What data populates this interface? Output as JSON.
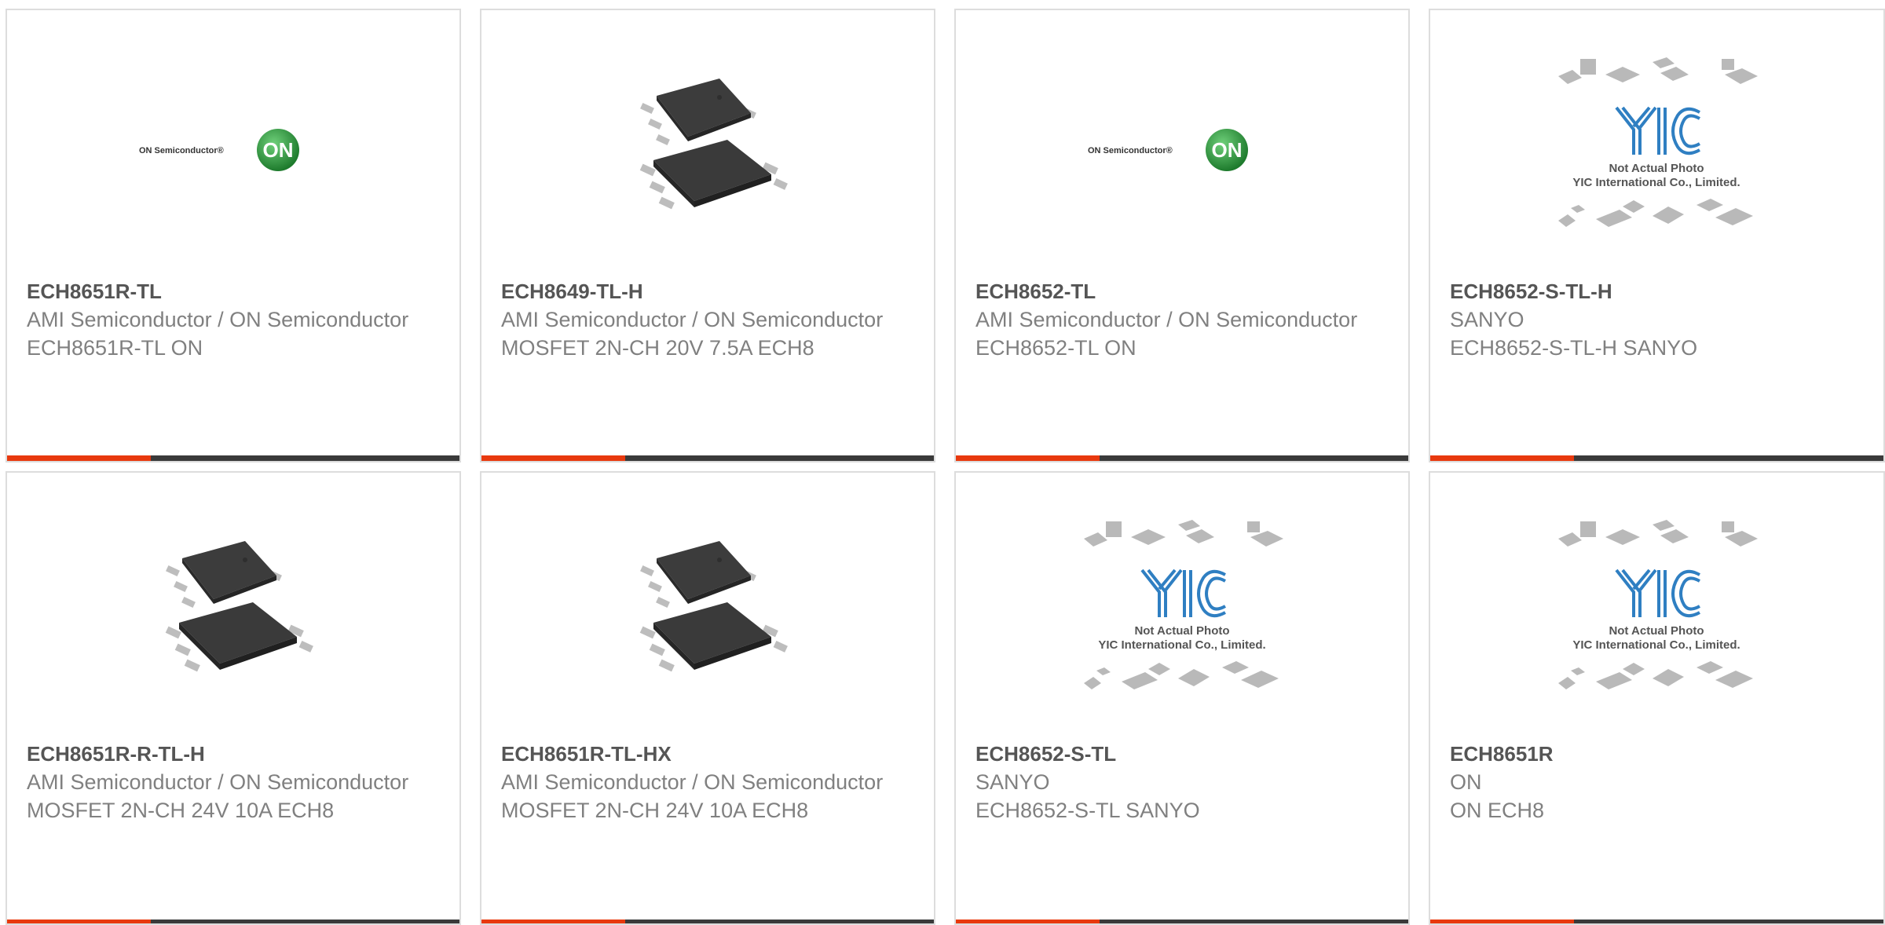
{
  "colors": {
    "accent": "#e8390e",
    "bar_dark": "#3a3a3a",
    "part_text": "#555555",
    "meta_text": "#808080",
    "on_green": "#2e9a3c",
    "yic_blue": "#2f7fc2"
  },
  "products": [
    {
      "part_number": "ECH8651R-TL",
      "manufacturer": "AMI Semiconductor / ON Semiconductor",
      "description": "ECH8651R-TL ON",
      "image": "on-semiconductor-logo",
      "logo_text": "ON Semiconductor®",
      "badge": "ON"
    },
    {
      "part_number": "ECH8649-TL-H",
      "manufacturer": "AMI Semiconductor / ON Semiconductor",
      "description": "MOSFET 2N-CH 20V 7.5A ECH8",
      "image": "ech8-chip-photo"
    },
    {
      "part_number": "ECH8652-TL",
      "manufacturer": "AMI Semiconductor / ON Semiconductor",
      "description": "ECH8652-TL ON",
      "image": "on-semiconductor-logo",
      "logo_text": "ON Semiconductor®",
      "badge": "ON"
    },
    {
      "part_number": "ECH8652-S-TL-H",
      "manufacturer": "SANYO",
      "description": "ECH8652-S-TL-H SANYO",
      "image": "yic-placeholder",
      "placeholder_line1": "Not Actual Photo",
      "placeholder_line2": "YIC International Co., Limited."
    },
    {
      "part_number": "ECH8651R-R-TL-H",
      "manufacturer": "AMI Semiconductor / ON Semiconductor",
      "description": "MOSFET 2N-CH 24V 10A ECH8",
      "image": "ech8-chip-photo"
    },
    {
      "part_number": "ECH8651R-TL-HX",
      "manufacturer": "AMI Semiconductor / ON Semiconductor",
      "description": "MOSFET 2N-CH 24V 10A ECH8",
      "image": "ech8-chip-photo"
    },
    {
      "part_number": "ECH8652-S-TL",
      "manufacturer": "SANYO",
      "description": "ECH8652-S-TL SANYO",
      "image": "yic-placeholder",
      "placeholder_line1": "Not Actual Photo",
      "placeholder_line2": "YIC International Co., Limited."
    },
    {
      "part_number": "ECH8651R",
      "manufacturer": "ON",
      "description": "ON ECH8",
      "image": "yic-placeholder",
      "placeholder_line1": "Not Actual Photo",
      "placeholder_line2": "YIC International Co., Limited."
    }
  ]
}
